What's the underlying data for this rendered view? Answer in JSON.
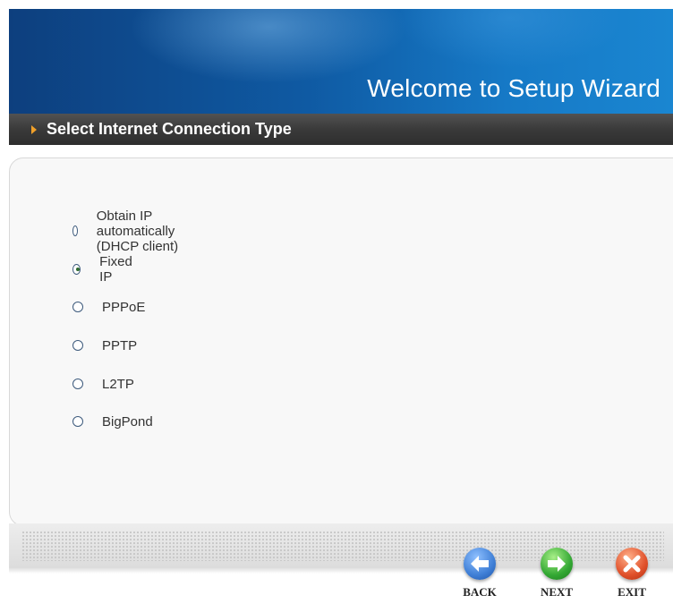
{
  "banner": {
    "title": "Welcome to Setup Wizard"
  },
  "section": {
    "title": "Select Internet Connection Type"
  },
  "connection_options": [
    {
      "label": "Obtain IP automatically (DHCP client)",
      "selected": false
    },
    {
      "label": "Fixed IP",
      "selected": true
    },
    {
      "label": "PPPoE",
      "selected": false
    },
    {
      "label": "PPTP",
      "selected": false
    },
    {
      "label": "L2TP",
      "selected": false
    },
    {
      "label": "BigPond",
      "selected": false
    }
  ],
  "nav": {
    "back": {
      "label": "BACK",
      "icon": "arrow-left-icon",
      "color": "#3f7fd6"
    },
    "next": {
      "label": "NEXT",
      "icon": "arrow-right-icon",
      "color": "#33a833"
    },
    "exit": {
      "label": "EXIT",
      "icon": "x-icon",
      "color": "#e0502a"
    }
  }
}
